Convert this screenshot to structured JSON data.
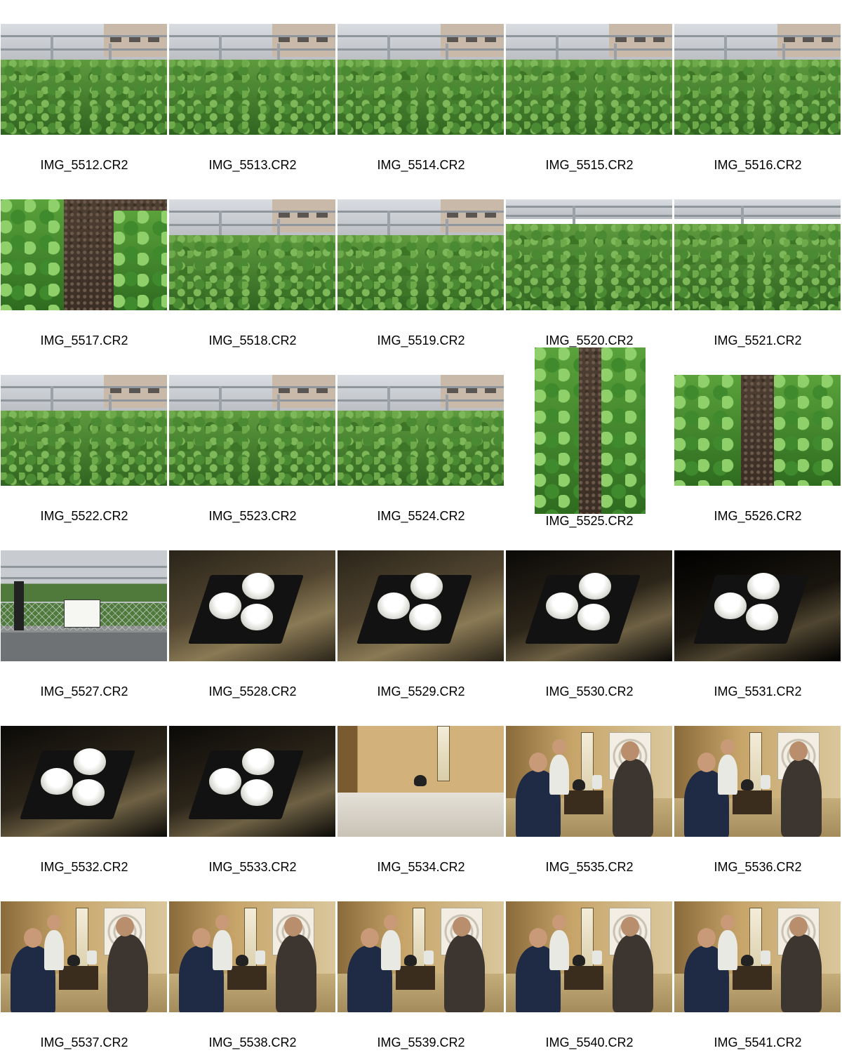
{
  "contact_sheet": {
    "items": [
      {
        "caption": "IMG_5512.CR2",
        "scene": "tea-field",
        "orientation": "landscape"
      },
      {
        "caption": "IMG_5513.CR2",
        "scene": "tea-field",
        "orientation": "landscape"
      },
      {
        "caption": "IMG_5514.CR2",
        "scene": "tea-field",
        "orientation": "landscape"
      },
      {
        "caption": "IMG_5515.CR2",
        "scene": "tea-field",
        "orientation": "landscape"
      },
      {
        "caption": "IMG_5516.CR2",
        "scene": "tea-field",
        "orientation": "landscape"
      },
      {
        "caption": "IMG_5517.CR2",
        "scene": "tea-path-top",
        "orientation": "landscape"
      },
      {
        "caption": "IMG_5518.CR2",
        "scene": "tea-field",
        "orientation": "landscape"
      },
      {
        "caption": "IMG_5519.CR2",
        "scene": "tea-field",
        "orientation": "landscape"
      },
      {
        "caption": "IMG_5520.CR2",
        "scene": "tea-field-close",
        "orientation": "landscape"
      },
      {
        "caption": "IMG_5521.CR2",
        "scene": "tea-field-close",
        "orientation": "landscape"
      },
      {
        "caption": "IMG_5522.CR2",
        "scene": "tea-field",
        "orientation": "landscape"
      },
      {
        "caption": "IMG_5523.CR2",
        "scene": "tea-field",
        "orientation": "landscape"
      },
      {
        "caption": "IMG_5524.CR2",
        "scene": "tea-field",
        "orientation": "landscape"
      },
      {
        "caption": "IMG_5525.CR2",
        "scene": "tea-row-path",
        "orientation": "portrait"
      },
      {
        "caption": "IMG_5526.CR2",
        "scene": "tea-row-path",
        "orientation": "landscape"
      },
      {
        "caption": "IMG_5527.CR2",
        "scene": "fence-sign",
        "orientation": "landscape"
      },
      {
        "caption": "IMG_5528.CR2",
        "scene": "tea-cups",
        "orientation": "landscape"
      },
      {
        "caption": "IMG_5529.CR2",
        "scene": "tea-cups",
        "orientation": "landscape"
      },
      {
        "caption": "IMG_5530.CR2",
        "scene": "tea-cups-dark",
        "orientation": "landscape"
      },
      {
        "caption": "IMG_5531.CR2",
        "scene": "tea-cups-darker",
        "orientation": "landscape"
      },
      {
        "caption": "IMG_5532.CR2",
        "scene": "tea-cups-dark",
        "orientation": "landscape"
      },
      {
        "caption": "IMG_5533.CR2",
        "scene": "tea-cups-dark",
        "orientation": "landscape"
      },
      {
        "caption": "IMG_5534.CR2",
        "scene": "tea-room-alcove",
        "orientation": "landscape"
      },
      {
        "caption": "IMG_5535.CR2",
        "scene": "tea-ceremony",
        "orientation": "landscape"
      },
      {
        "caption": "IMG_5536.CR2",
        "scene": "tea-ceremony",
        "orientation": "landscape"
      },
      {
        "caption": "IMG_5537.CR2",
        "scene": "tea-ceremony",
        "orientation": "landscape"
      },
      {
        "caption": "IMG_5538.CR2",
        "scene": "tea-ceremony",
        "orientation": "landscape"
      },
      {
        "caption": "IMG_5539.CR2",
        "scene": "tea-ceremony",
        "orientation": "landscape"
      },
      {
        "caption": "IMG_5540.CR2",
        "scene": "tea-ceremony",
        "orientation": "landscape"
      },
      {
        "caption": "IMG_5541.CR2",
        "scene": "tea-ceremony",
        "orientation": "landscape"
      }
    ]
  }
}
